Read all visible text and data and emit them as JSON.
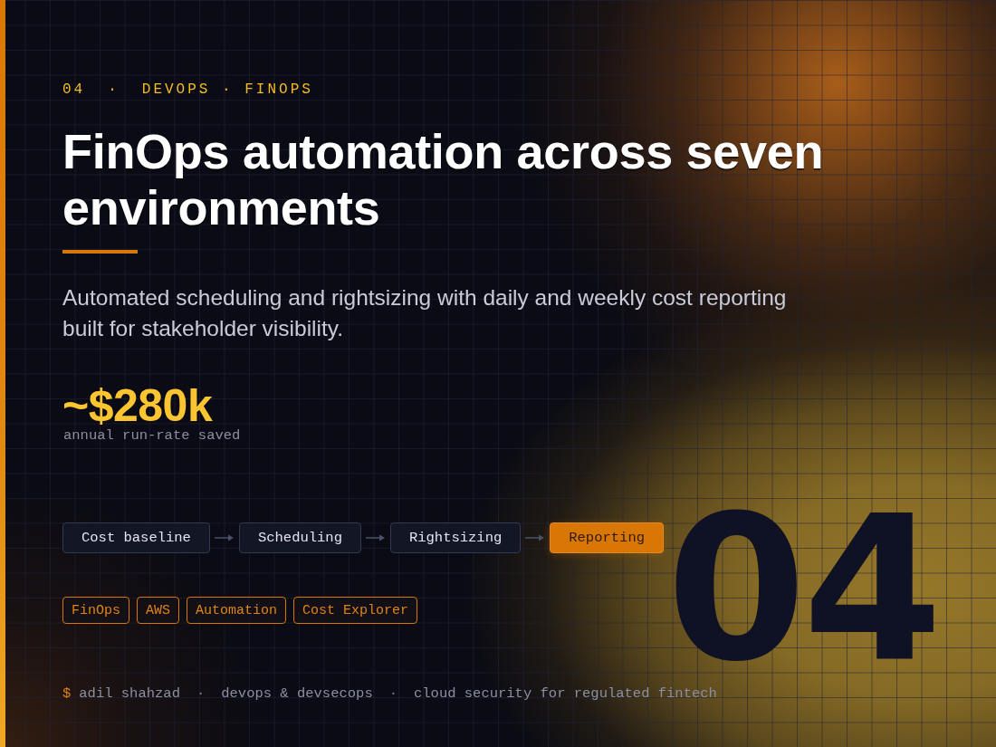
{
  "eyebrow": {
    "number": "04",
    "separator": "·",
    "category": "DEVOPS · FINOPS"
  },
  "title": "FinOps automation across seven environments",
  "summary": "Automated scheduling and rightsizing with daily and weekly cost reporting built for stakeholder visibility.",
  "metric": {
    "value": "~$280k",
    "label": "annual run-rate saved"
  },
  "pipeline": [
    {
      "label": "Cost baseline",
      "selected": false
    },
    {
      "label": "Scheduling",
      "selected": false
    },
    {
      "label": "Rightsizing",
      "selected": false
    },
    {
      "label": "Reporting",
      "selected": true
    }
  ],
  "tags": [
    "FinOps",
    "AWS",
    "Automation",
    "Cost Explorer"
  ],
  "big_number": "04",
  "footer": {
    "prompt": "$",
    "segments": [
      {
        "kind": "text",
        "text": "adil shahzad"
      },
      {
        "kind": "separator",
        "text": "·"
      },
      {
        "kind": "text",
        "text": "devops & devsecops"
      },
      {
        "kind": "separator",
        "text": "·"
      },
      {
        "kind": "text",
        "text": "cloud security for regulated fintech"
      }
    ]
  }
}
